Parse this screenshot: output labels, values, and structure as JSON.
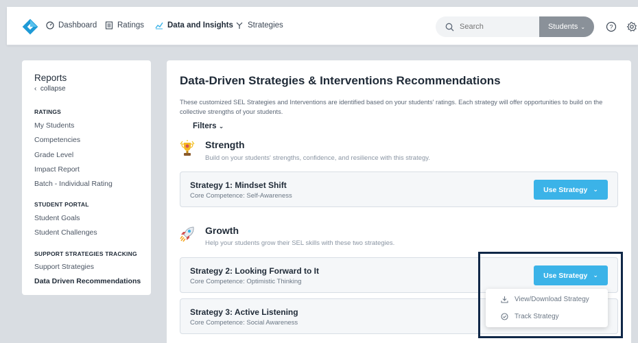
{
  "nav": {
    "items": [
      {
        "label": "Dashboard",
        "icon": "dashboard-icon"
      },
      {
        "label": "Ratings",
        "icon": "ratings-icon"
      },
      {
        "label": "Data and Insights",
        "icon": "insights-icon",
        "active": true
      },
      {
        "label": "Strategies",
        "icon": "strategies-icon"
      }
    ],
    "search_placeholder": "Search",
    "students_label": "Students",
    "colors": {
      "logo": "#1e9ad6",
      "accent": "#3bb3e8",
      "students_button": "#8a9199"
    }
  },
  "sidebar": {
    "title": "Reports",
    "collapse_label": "collapse",
    "sections": [
      {
        "label": "RATINGS",
        "links": [
          "My Students",
          "Competencies",
          "Grade Level",
          "Impact Report",
          "Batch - Individual Rating"
        ]
      },
      {
        "label": "STUDENT PORTAL",
        "links": [
          "Student Goals",
          "Student Challenges"
        ]
      },
      {
        "label": "SUPPORT STRATEGIES TRACKING",
        "links": [
          "Support Strategies",
          "Data Driven Recommendations"
        ]
      }
    ],
    "active_link": "Data Driven Recommendations"
  },
  "main": {
    "title": "Data-Driven Strategies & Interventions Recommendations",
    "description": "These customized SEL Strategies and Interventions are identified based on your students' ratings. Each strategy will offer opportunities to build on the collective strengths of your students.",
    "filters_label": "Filters",
    "categories": [
      {
        "title": "Strength",
        "description": "Build on your students' strengths, confidence, and resilience with this strategy.",
        "icon": "trophy-icon"
      },
      {
        "title": "Growth",
        "description": "Help your students grow their SEL skills with these two strategies.",
        "icon": "rocket-icon"
      }
    ],
    "strategies": [
      {
        "title": "Strategy 1: Mindset Shift",
        "competence": "Core Competence: Self-Awareness",
        "button": "Use Strategy"
      },
      {
        "title": "Strategy 2: Looking Forward to It",
        "competence": "Core Competence: Optimistic Thinking",
        "button": "Use Strategy"
      },
      {
        "title": "Strategy 3: Active Listening",
        "competence": "Core Competence: Social Awareness"
      }
    ],
    "dropdown": [
      "View/Download Strategy",
      "Track Strategy"
    ]
  }
}
